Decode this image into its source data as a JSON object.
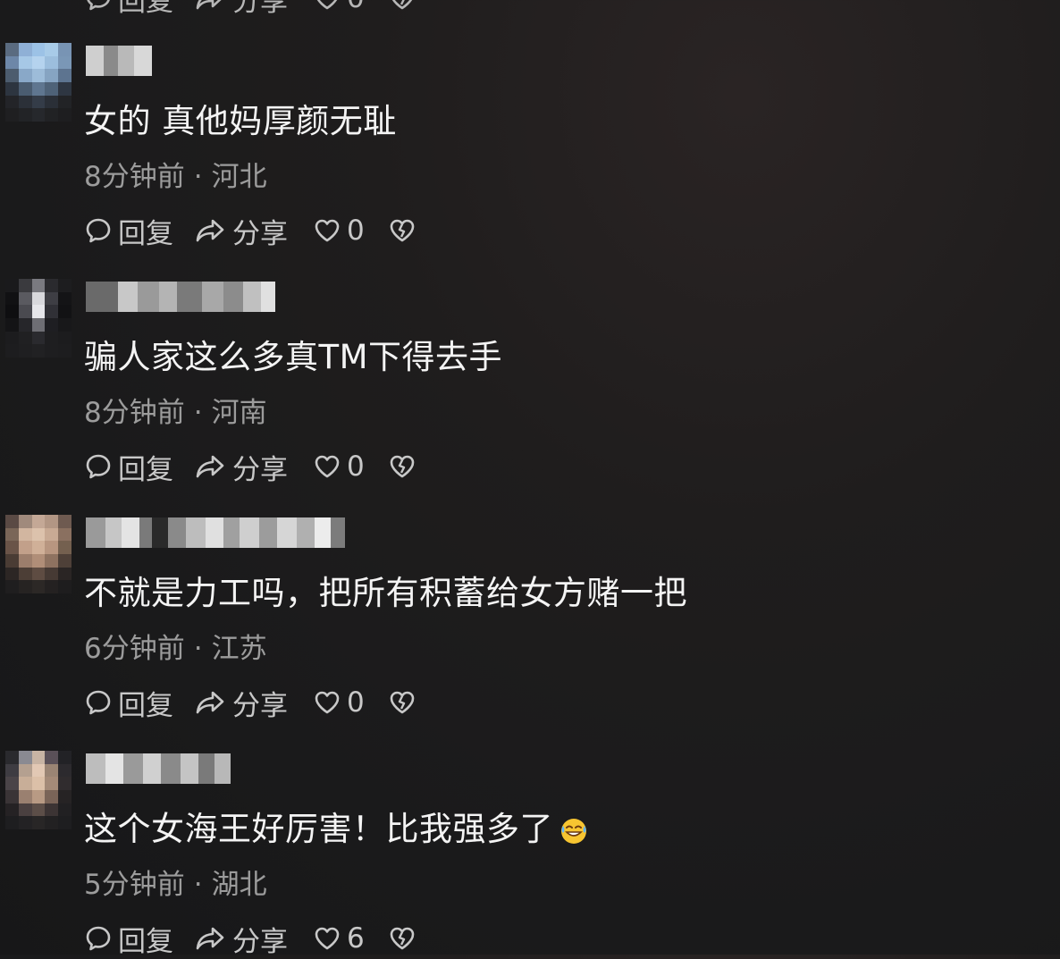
{
  "actions": {
    "reply": "回复",
    "share": "分享"
  },
  "top_partial": {
    "reply": "回复",
    "share": "分享",
    "likes": "0"
  },
  "comments": [
    {
      "text": "女的 真他妈厚颜无耻",
      "time": "8分钟前",
      "location": "河北",
      "likes": "0"
    },
    {
      "text": "骗人家这么多真TM下得去手",
      "time": "8分钟前",
      "location": "河南",
      "likes": "0"
    },
    {
      "text": "不就是力工吗，把所有积蓄给女方赌一把",
      "time": "6分钟前",
      "location": "江苏",
      "likes": "0"
    },
    {
      "text": "这个女海王好厉害！比我强多了",
      "emoji": "laugh-cry-emoji",
      "time": "5分钟前",
      "location": "湖北",
      "likes": "6"
    }
  ],
  "colors": {
    "background": "#1c1b1c",
    "text": "#f4f4f4",
    "meta": "#9c9c9c",
    "action": "#c8c8c8"
  }
}
